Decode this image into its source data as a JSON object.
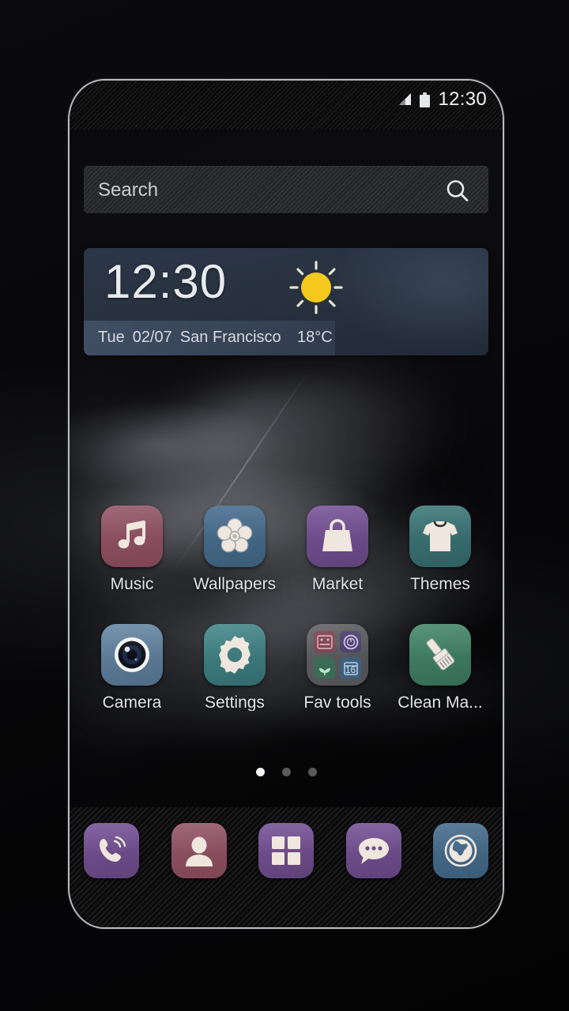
{
  "device": {
    "frame_color": "#b9bcc0"
  },
  "status_bar": {
    "time": "12:30",
    "signal_icon": "signal-triangle-icon",
    "battery_icon": "battery-icon"
  },
  "search": {
    "placeholder": "Search",
    "icon": "search-icon"
  },
  "clock_widget": {
    "time": "12:30",
    "weather_icon": "sun-icon",
    "day": "Tue",
    "date": "02/07",
    "city": "San Francisco",
    "temperature": "18°C",
    "accent": "#2b3648"
  },
  "app_grid": {
    "rows": [
      {
        "apps": [
          {
            "label": "Music",
            "icon": "music-note-icon",
            "color": "#8a4e5e",
            "glyph_color": "#efe6dd"
          },
          {
            "label": "Wallpapers",
            "icon": "flower-icon",
            "color": "#3f6480",
            "glyph_color": "#efe6dd"
          },
          {
            "label": "Market",
            "icon": "shopping-bag-icon",
            "color": "#6a4a86",
            "glyph_color": "#efe6dd"
          },
          {
            "label": "Themes",
            "icon": "tshirt-icon",
            "color": "#35696a",
            "glyph_color": "#efe6dd"
          }
        ]
      },
      {
        "apps": [
          {
            "label": "Camera",
            "icon": "camera-lens-icon",
            "color": "#5b7b96",
            "glyph_color": "#f2f2f4"
          },
          {
            "label": "Settings",
            "icon": "gear-icon",
            "color": "#3c7a7c",
            "glyph_color": "#efe6dd"
          },
          {
            "label": "Fav tools",
            "icon": "folder-icon",
            "color": "#7e7e82",
            "glyph_color": "#efe6dd"
          },
          {
            "label": "Clean Ma...",
            "icon": "brush-icon",
            "color": "#3d7a5e",
            "glyph_color": "#efe6dd"
          }
        ]
      }
    ],
    "folder_items": [
      {
        "name": "calculator-mini-icon",
        "color": "#7c4350",
        "label": ""
      },
      {
        "name": "clock-mini-icon",
        "color": "#4a3f6b",
        "label": ""
      },
      {
        "name": "plant-mini-icon",
        "color": "#3a6b54",
        "label": ""
      },
      {
        "name": "calendar-mini-icon",
        "color": "#3d5f7e",
        "label": "16"
      }
    ]
  },
  "page_indicator": {
    "total": 3,
    "active_index": 0
  },
  "dock": {
    "items": [
      {
        "label": "Phone",
        "icon": "phone-icon",
        "color": "#6a4a86"
      },
      {
        "label": "Contacts",
        "icon": "contact-icon",
        "color": "#8a4e5e"
      },
      {
        "label": "Apps",
        "icon": "app-drawer-icon",
        "color": "#6a4a86"
      },
      {
        "label": "Messages",
        "icon": "message-icon",
        "color": "#6a4a86"
      },
      {
        "label": "Browser",
        "icon": "globe-icon",
        "color": "#3f6480"
      }
    ]
  }
}
